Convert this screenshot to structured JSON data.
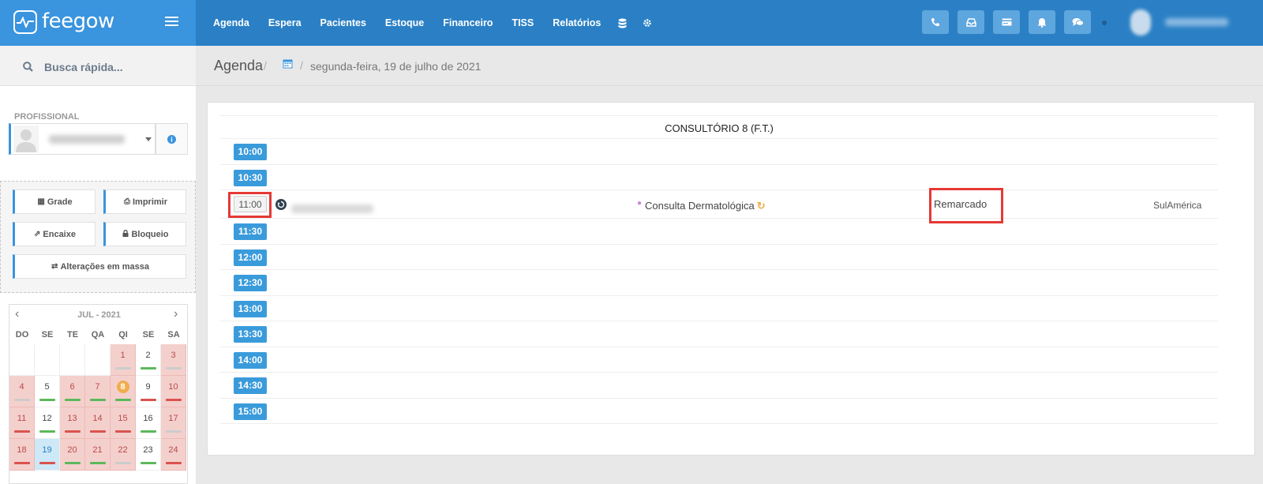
{
  "brand": {
    "name": "feegow"
  },
  "nav": {
    "items": [
      "Agenda",
      "Espera",
      "Pacientes",
      "Estoque",
      "Financeiro",
      "TISS",
      "Relatórios"
    ],
    "icons": [
      "database-icon",
      "gear-icon"
    ]
  },
  "toolbar": {
    "icons": [
      "phone-icon",
      "inbox-icon",
      "card-icon",
      "bell-icon",
      "chat-icon"
    ]
  },
  "sidebar": {
    "search_placeholder": "Busca rápida...",
    "profissional_label": "PROFISSIONAL",
    "actions": {
      "grade": "Grade",
      "imprimir": "Imprimir",
      "encaixe": "Encaixe",
      "bloqueio": "Bloqueio",
      "alteracoes": "Alterações em massa"
    },
    "calendar": {
      "title": "JUL - 2021",
      "weekdays": [
        "DO",
        "SE",
        "TE",
        "QA",
        "QI",
        "SE",
        "SA"
      ],
      "weeks": [
        [
          "",
          "",
          "",
          "",
          "1",
          "2",
          "3"
        ],
        [
          "4",
          "5",
          "6",
          "7",
          "8",
          "9",
          "10"
        ],
        [
          "11",
          "12",
          "13",
          "14",
          "15",
          "16",
          "17"
        ],
        [
          "18",
          "19",
          "20",
          "21",
          "22",
          "23",
          "24"
        ]
      ],
      "selected_day": "19",
      "highlight_day": "8"
    }
  },
  "header": {
    "title": "Agenda",
    "date": "segunda-feira, 19 de julho de 2021"
  },
  "agenda": {
    "room": "CONSULTÓRIO 8 (F.T.)",
    "slots": [
      "10:00",
      "10:30",
      "11:00",
      "11:30",
      "12:00",
      "12:30",
      "13:00",
      "13:30",
      "14:00",
      "14:30",
      "15:00"
    ],
    "appointment": {
      "time": "11:00",
      "procedure": "Consulta Dermatológica",
      "status": "Remarcado",
      "insurance": "SulAmérica"
    }
  },
  "colors": {
    "topbar": "#2b80c5",
    "brand": "#3a94de",
    "slot_button": "#3a9bdb",
    "highlight_box": "#e53935"
  }
}
